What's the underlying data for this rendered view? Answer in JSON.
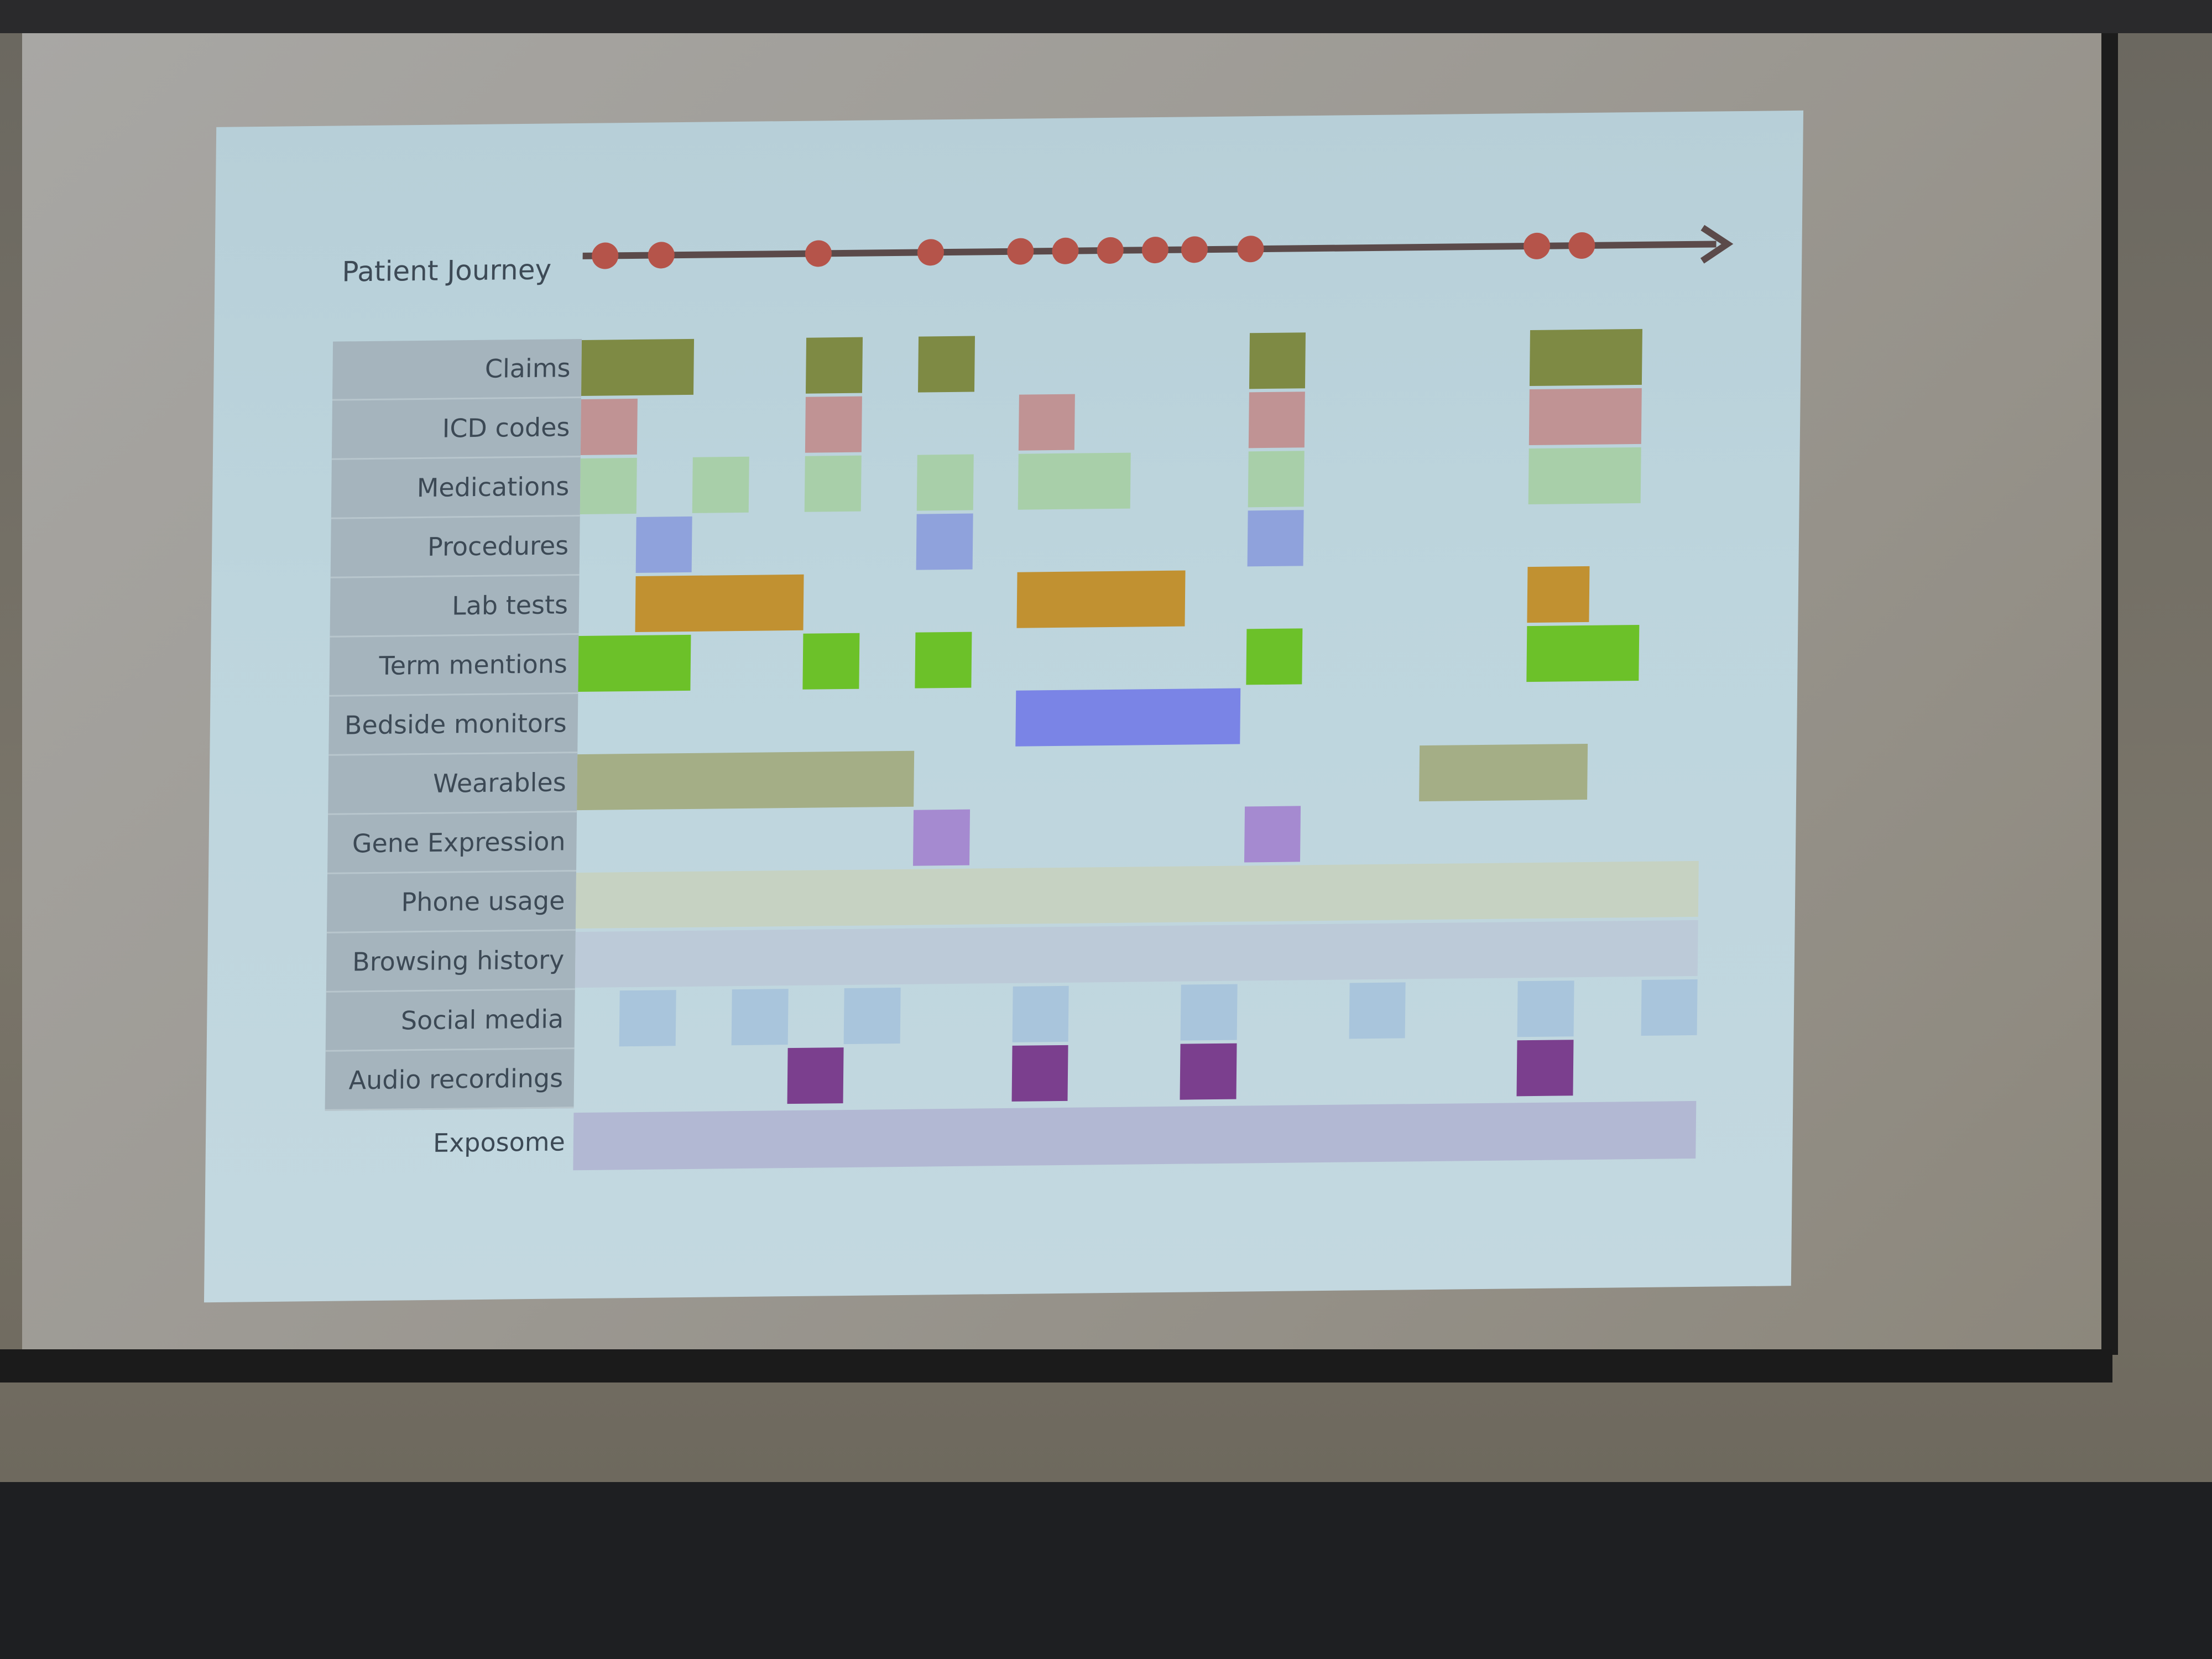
{
  "diagram": {
    "journey_label": "Patient Journey",
    "journey_events": [
      0.02,
      0.07,
      0.21,
      0.31,
      0.39,
      0.43,
      0.47,
      0.51,
      0.545,
      0.595,
      0.85,
      0.89
    ],
    "rows": [
      {
        "label": "Claims",
        "color": "#7e8a44",
        "boxes": [
          [
            0.0,
            0.1
          ],
          [
            0.2,
            0.25
          ],
          [
            0.3,
            0.35
          ],
          [
            0.595,
            0.645
          ],
          [
            0.845,
            0.945
          ]
        ]
      },
      {
        "label": "ICD codes",
        "color": "#c09394",
        "boxes": [
          [
            0.0,
            0.05
          ],
          [
            0.2,
            0.25
          ],
          [
            0.39,
            0.44
          ],
          [
            0.595,
            0.645
          ],
          [
            0.845,
            0.945
          ]
        ]
      },
      {
        "label": "Medications",
        "color": "#a8cfa9",
        "boxes": [
          [
            0.0,
            0.05
          ],
          [
            0.1,
            0.15
          ],
          [
            0.2,
            0.25
          ],
          [
            0.3,
            0.35
          ],
          [
            0.39,
            0.49
          ],
          [
            0.595,
            0.645
          ],
          [
            0.845,
            0.945
          ]
        ]
      },
      {
        "label": "Procedures",
        "color": "#8fa2dc",
        "boxes": [
          [
            0.05,
            0.1
          ],
          [
            0.3,
            0.35
          ],
          [
            0.595,
            0.645
          ]
        ]
      },
      {
        "label": "Lab tests",
        "color": "#c19131",
        "boxes": [
          [
            0.05,
            0.2
          ],
          [
            0.39,
            0.54
          ],
          [
            0.845,
            0.9
          ]
        ]
      },
      {
        "label": "Term mentions",
        "color": "#6cc129",
        "boxes": [
          [
            0.0,
            0.1
          ],
          [
            0.2,
            0.25
          ],
          [
            0.3,
            0.35
          ],
          [
            0.595,
            0.645
          ],
          [
            0.845,
            0.945
          ]
        ]
      },
      {
        "label": "Bedside monitors",
        "color": "#7a84e6",
        "boxes": [
          [
            0.39,
            0.59
          ]
        ]
      },
      {
        "label": "Wearables",
        "color": "#a4ae86",
        "boxes": [
          [
            0.0,
            0.3
          ],
          [
            0.75,
            0.9
          ]
        ]
      },
      {
        "label": "Gene Expression",
        "color": "#a58ad0",
        "boxes": [
          [
            0.3,
            0.35
          ],
          [
            0.595,
            0.645
          ]
        ]
      },
      {
        "label": "Phone usage",
        "color": "#c6d2c2",
        "boxes": [
          [
            0.0,
            1.0
          ]
        ]
      },
      {
        "label": "Browsing history",
        "color": "#bccad8",
        "boxes": [
          [
            0.0,
            1.0
          ]
        ]
      },
      {
        "label": "Social media",
        "color": "#a9c5dc",
        "boxes": [
          [
            0.04,
            0.09
          ],
          [
            0.14,
            0.19
          ],
          [
            0.24,
            0.29
          ],
          [
            0.39,
            0.44
          ],
          [
            0.54,
            0.59
          ],
          [
            0.69,
            0.74
          ],
          [
            0.84,
            0.89
          ],
          [
            0.95,
            1.0
          ]
        ]
      },
      {
        "label": "Audio recordings",
        "color": "#7b3f8e",
        "boxes": [
          [
            0.19,
            0.24
          ],
          [
            0.39,
            0.44
          ],
          [
            0.54,
            0.59
          ],
          [
            0.84,
            0.89
          ]
        ]
      }
    ],
    "exposome": {
      "label": "Exposome",
      "color": "#b2b8d3"
    },
    "colors": {
      "timeline": "#5b4a4a",
      "event_dot": "#b5544a",
      "label_panel": "#a5b4bd",
      "slide_bg": "#bdd5dd"
    }
  }
}
